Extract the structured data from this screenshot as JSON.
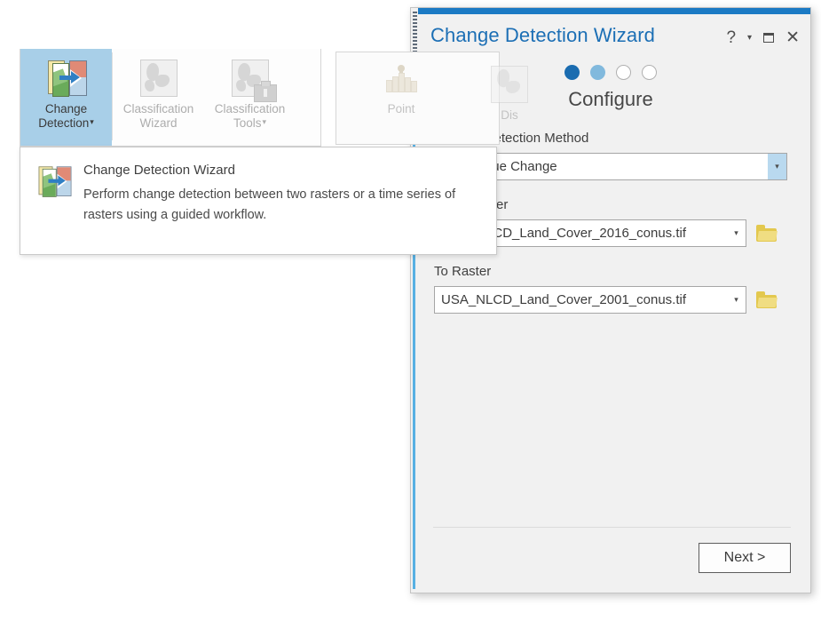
{
  "ribbon": {
    "buttons": [
      {
        "label_line1": "Change",
        "label_line2": "Detection",
        "icon": "change-detection-icon",
        "has_caret": true,
        "state": "active"
      },
      {
        "label_line1": "Classification",
        "label_line2": "Wizard",
        "icon": "classification-wizard-icon",
        "has_caret": false,
        "state": "disabled"
      },
      {
        "label_line1": "Classification",
        "label_line2": "Tools",
        "icon": "classification-tools-icon",
        "has_caret": true,
        "state": "disabled"
      },
      {
        "label_line1": "Point",
        "label_line2": "",
        "icon": "point-icon",
        "has_caret": false,
        "state": "disabled"
      },
      {
        "label_line1": "Dis",
        "label_line2": "",
        "icon": "disabled-tool-icon",
        "has_caret": false,
        "state": "disabled"
      }
    ],
    "caret_glyph": "▾"
  },
  "tooltip": {
    "icon": "change-detection-icon",
    "title": "Change Detection Wizard",
    "description": "Perform change detection between two rasters or a time series of rasters using a guided workflow."
  },
  "wizard": {
    "title": "Change Detection Wizard",
    "controls": {
      "help": "?",
      "caret": "▾",
      "maximize": "maximize-icon",
      "close": "✕"
    },
    "steps": {
      "total": 4,
      "states": [
        "done",
        "current",
        "todo",
        "todo"
      ]
    },
    "stage_label": "Configure",
    "fields": [
      {
        "label": "Change Detection Method",
        "value": "Pixel Value Change",
        "arrow_glyph": "▾",
        "hover": true,
        "has_browse": false
      },
      {
        "label": "From Raster",
        "value": "USA_NLCD_Land_Cover_2016_conus.tif",
        "arrow_glyph": "▾",
        "hover": false,
        "has_browse": true,
        "browse_icon": "folder-icon"
      },
      {
        "label": "To Raster",
        "value": "USA_NLCD_Land_Cover_2001_conus.tif",
        "arrow_glyph": "▾",
        "hover": false,
        "has_browse": true,
        "browse_icon": "folder-icon"
      }
    ],
    "next_button": "Next >"
  },
  "colors": {
    "title_blue": "#1c6fb5",
    "accent_bar": "#1b7ac4",
    "step_done": "#1a6cb0",
    "step_current": "#81b9dd",
    "ribbon_active": "#a8cfe8",
    "folder_gold": "#e3c84e"
  }
}
